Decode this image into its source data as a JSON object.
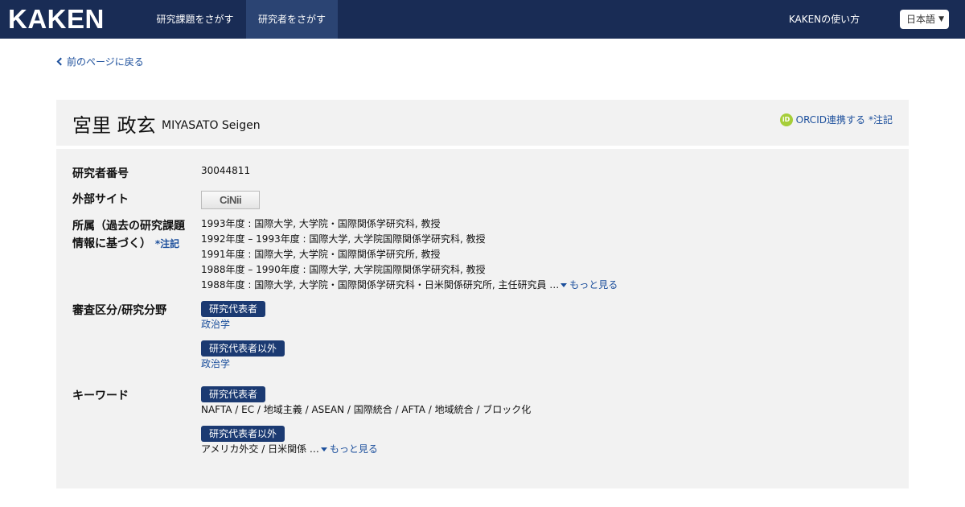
{
  "header": {
    "logo": "KAKEN",
    "nav": [
      "研究課題をさがす",
      "研究者をさがす"
    ],
    "how_to": "KAKENの使い方",
    "language": "日本語"
  },
  "back_link": "前のページに戻る",
  "researcher": {
    "name_ja": "宮里 政玄",
    "name_en": "MIYASATO Seigen",
    "orcid": "ORCID連携する",
    "orcid_note": "*注記"
  },
  "fields": {
    "number_label": "研究者番号",
    "number": "30044811",
    "external_label": "外部サイト",
    "cinii": "CiNii",
    "affiliation_label_1": "所属（過去の研究課題",
    "affiliation_label_2": "情報に基づく）",
    "affiliation_note": "*注記",
    "affiliations": [
      "1993年度 : 国際大学, 大学院・国際関係学研究科, 教授",
      "1992年度 – 1993年度 : 国際大学, 大学院国際関係学研究科, 教授",
      "1991年度 : 国際大学, 大学院・国際関係学研究所, 教授",
      "1988年度 – 1990年度 : 国際大学, 大学院国際関係学研究科, 教授",
      "1988年度 : 国際大学, 大学院・国際関係学研究科・日米関係研究所, 主任研究員 …"
    ],
    "more": "もっと見る",
    "field_label": "審査区分/研究分野",
    "role_pi": "研究代表者",
    "role_other": "研究代表者以外",
    "field_pi": "政治学",
    "field_other": "政治学",
    "keyword_label": "キーワード",
    "keywords_pi": "NAFTA / EC / 地域主義 / ASEAN / 国際統合 / AFTA / 地域統合 / ブロック化",
    "keywords_other": "アメリカ外交 / 日米関係 …"
  },
  "colors": {
    "header_bg": "#192c55",
    "active_nav_bg": "#2b4473",
    "badge_bg": "#1b3a72",
    "link": "#1c4f9c",
    "panel_bg": "#f2f2f2",
    "orcid_green": "#a6ce39"
  }
}
